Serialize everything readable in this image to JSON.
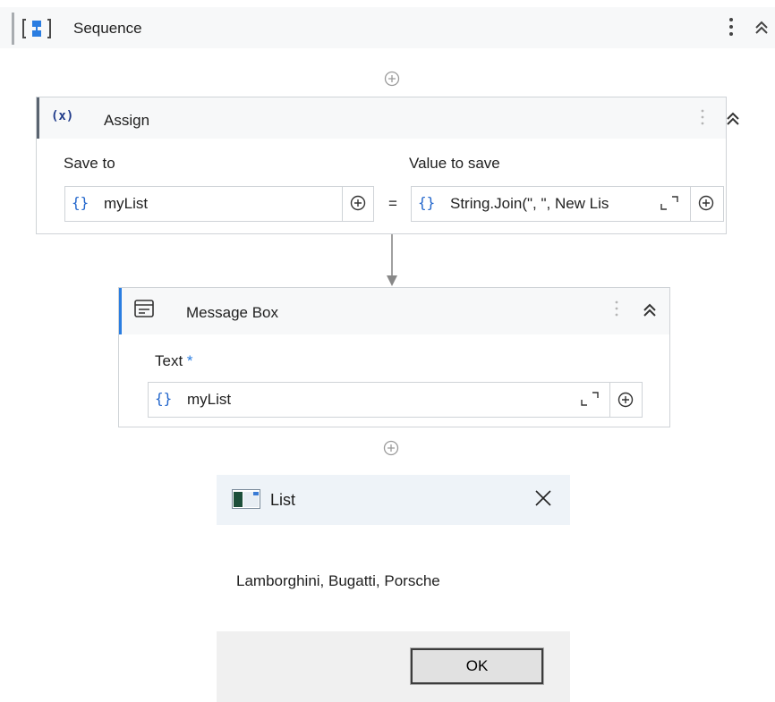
{
  "sequence": {
    "title": "Sequence",
    "icon": "sequence-icon"
  },
  "assign": {
    "title": "Assign",
    "icon_text": "(x)",
    "save_to_label": "Save to",
    "save_to_value": "myList",
    "equals": "=",
    "value_label": "Value to save",
    "value_value": "String.Join(\", \", New Lis",
    "brace": "{}"
  },
  "message_box": {
    "title": "Message Box",
    "text_label": "Text",
    "required_mark": "*",
    "text_value": "myList",
    "brace": "{}"
  },
  "dialog": {
    "title": "List",
    "message": "Lamborghini, Bugatti, Porsche",
    "ok_label": "OK"
  },
  "colors": {
    "accent_blue": "#2a7de1",
    "brace_blue": "#2266cc",
    "header_gray": "#f7f8f9",
    "border_gray": "#cfd3d7"
  }
}
